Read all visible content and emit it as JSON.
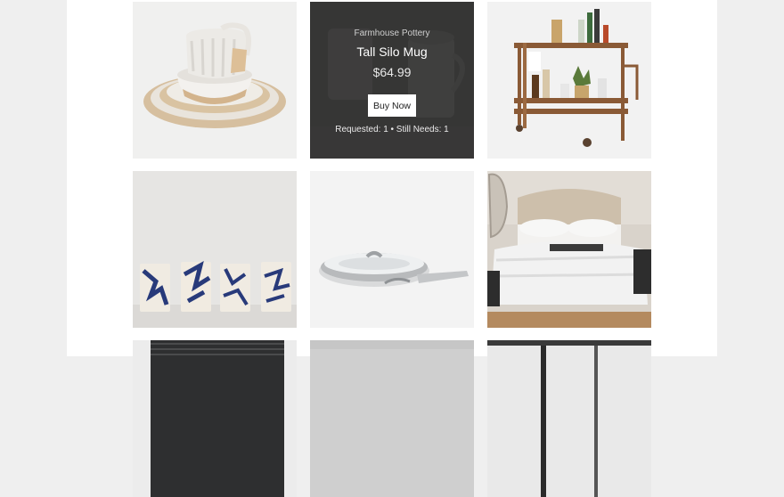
{
  "hover_product": {
    "brand": "Farmhouse Pottery",
    "name": "Tall Silo Mug",
    "price": "$64.99",
    "button_label": "Buy Now",
    "requested_label": "Requested: 1 • Still Needs: 1"
  },
  "products": [
    {
      "image": "stacked-ceramic-dishware"
    },
    {
      "image": "tall-silo-mug"
    },
    {
      "image": "bar-cart"
    },
    {
      "image": "splatter-ceramic-cups"
    },
    {
      "image": "stainless-steel-skillet"
    },
    {
      "image": "upholstered-bed"
    },
    {
      "image": "woven-rug"
    },
    {
      "image": "gray-product"
    },
    {
      "image": "mirror-product"
    }
  ],
  "colors": {
    "page_background": "#efefef",
    "content_background": "#ffffff",
    "overlay": "#282828",
    "button_background": "#ffffff"
  }
}
